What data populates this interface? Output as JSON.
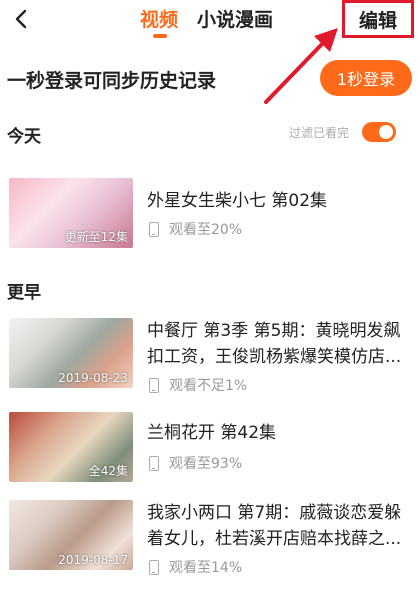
{
  "header": {
    "back_icon": "chevron-left-icon",
    "tabs": [
      {
        "label": "视频",
        "active": true
      },
      {
        "label": "小说漫画",
        "active": false
      }
    ],
    "edit_label": "编辑"
  },
  "login": {
    "prompt": "一秒登录可同步历史记录",
    "button_label": "1秒登录"
  },
  "today": {
    "heading": "今天",
    "filter_label": "过滤已看完",
    "filter_on": true,
    "items": [
      {
        "title": "外星女生柴小七 第02集",
        "progress": "观看至20%",
        "badge": "更新至12集"
      }
    ]
  },
  "earlier": {
    "heading": "更早",
    "items": [
      {
        "title": "中餐厅 第3季 第5期：黄晓明发飙扣工资，王俊凯杨紫爆笑模仿店...",
        "progress": "观看不足1%",
        "badge": "2019-08-23"
      },
      {
        "title": "兰桐花开 第42集",
        "progress": "观看至93%",
        "badge": "全42集"
      },
      {
        "title": "我家小两口 第7期：戚薇谈恋爱躲着女儿，杜若溪开店赔本找薛之...",
        "progress": "观看至14%",
        "badge": "2019-08-17"
      }
    ]
  },
  "colors": {
    "accent": "#ff6a1a",
    "annotation": "#e0192b"
  }
}
